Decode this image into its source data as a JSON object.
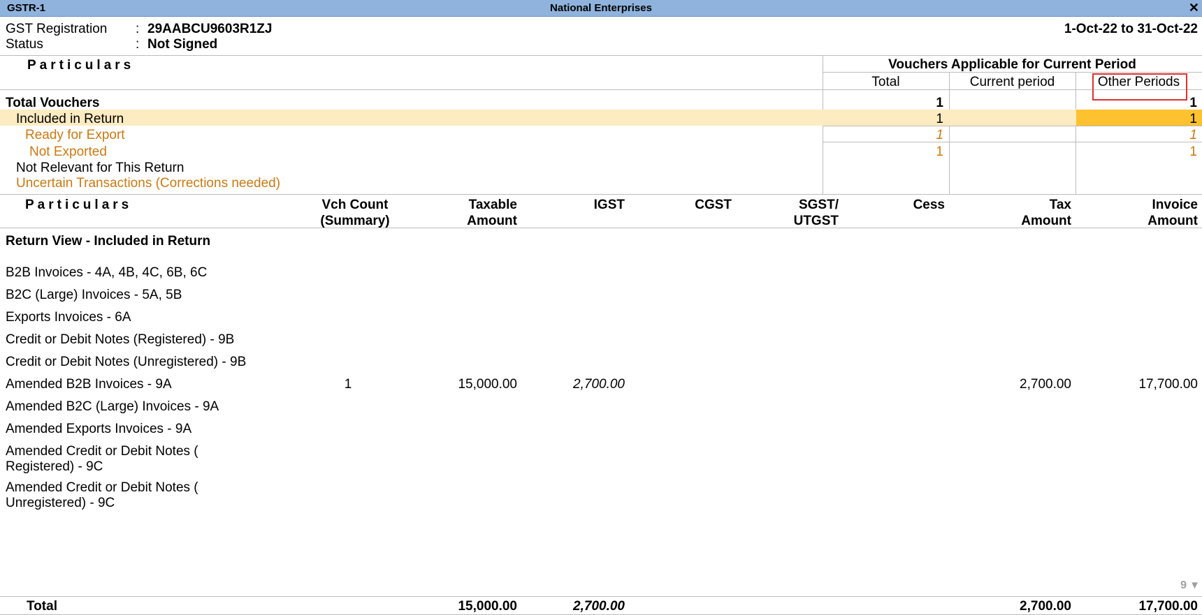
{
  "window": {
    "left_title": "GSTR-1",
    "center_title": "National Enterprises",
    "close_glyph": "✕"
  },
  "header": {
    "gst_label": "GST Registration",
    "gst_value": "29AABCU9603R1ZJ",
    "status_label": "Status",
    "status_value": "Not Signed",
    "colon": ":",
    "period": "1-Oct-22 to 31-Oct-22"
  },
  "summary": {
    "particulars_heading": "Particulars",
    "group_heading": "Vouchers Applicable for Current Period",
    "col_total": "Total",
    "col_current": "Current period",
    "col_other": "Other Periods",
    "rows": [
      {
        "label": "Total Vouchers",
        "total": "1",
        "current": "",
        "other": "1"
      },
      {
        "label": "Included in Return",
        "total": "1",
        "current": "",
        "other": "1"
      },
      {
        "label": "Ready for Export",
        "total": "1",
        "current": "",
        "other": "1"
      },
      {
        "label": "Not Exported",
        "total": "1",
        "current": "",
        "other": "1"
      },
      {
        "label": "Not Relevant for This Return",
        "total": "",
        "current": "",
        "other": ""
      },
      {
        "label": "Uncertain Transactions (Corrections needed)",
        "total": "",
        "current": "",
        "other": ""
      }
    ]
  },
  "details": {
    "headers": {
      "particulars": "Particulars",
      "vch_count_1": "Vch Count",
      "vch_count_2": "(Summary)",
      "taxable_1": "Taxable",
      "taxable_2": "Amount",
      "igst": "IGST",
      "cgst": "CGST",
      "sgst_1": "SGST/",
      "sgst_2": "UTGST",
      "cess": "Cess",
      "tax_1": "Tax",
      "tax_2": "Amount",
      "invoice_1": "Invoice",
      "invoice_2": "Amount"
    },
    "section_title": "Return View - Included in Return",
    "rows": [
      {
        "label": "B2B Invoices - 4A, 4B, 4C, 6B, 6C"
      },
      {
        "label": "B2C (Large) Invoices - 5A, 5B"
      },
      {
        "label": "Exports Invoices - 6A"
      },
      {
        "label": "Credit or Debit Notes (Registered) - 9B"
      },
      {
        "label": "Credit or Debit Notes (Unregistered) - 9B"
      },
      {
        "label": "Amended B2B Invoices - 9A",
        "vch_count": "1",
        "taxable": "15,000.00",
        "igst": "2,700.00",
        "tax": "2,700.00",
        "invoice": "17,700.00"
      },
      {
        "label": "Amended B2C (Large) Invoices - 9A"
      },
      {
        "label": "Amended Exports Invoices - 9A"
      },
      {
        "label": "Amended Credit or Debit Notes (",
        "label2": "Registered) - 9C"
      },
      {
        "label": "Amended Credit or Debit Notes (",
        "label2": "Unregistered) - 9C"
      }
    ],
    "page_indicator": "9",
    "page_arrow": "▼",
    "total": {
      "label": "Total",
      "taxable": "15,000.00",
      "igst": "2,700.00",
      "tax": "2,700.00",
      "invoice": "17,700.00"
    }
  },
  "colors": {
    "titlebar": "#8fb3dc",
    "highlight_row": "#fdebc2",
    "highlight_cell": "#fec12f",
    "orange_text": "#c87a14",
    "callout": "#e03030"
  }
}
